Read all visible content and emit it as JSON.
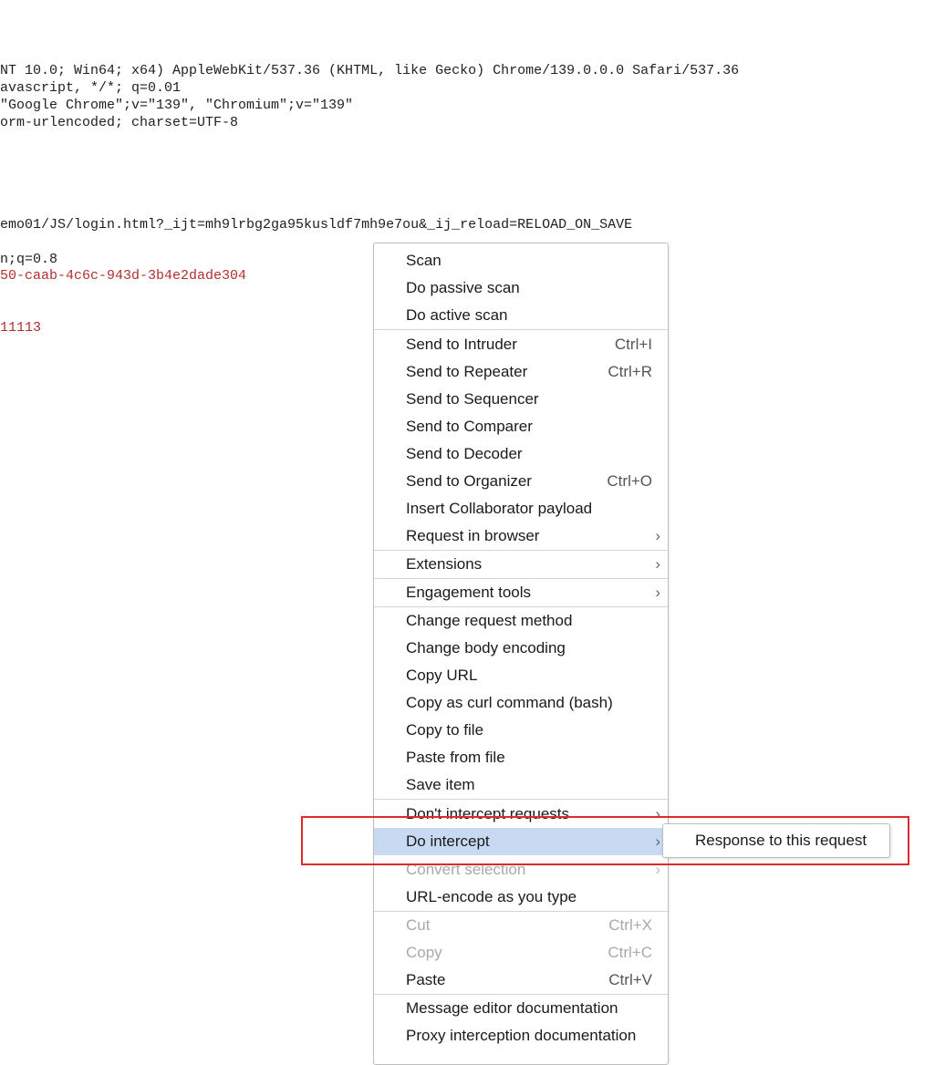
{
  "editor": {
    "lines": [
      {
        "text": "NT 10.0; Win64; x64) AppleWebKit/537.36 (KHTML, like Gecko) Chrome/139.0.0.0 Safari/537.36",
        "color": "#1f1f1f"
      },
      {
        "text": "avascript, */*; q=0.01",
        "color": "#1f1f1f"
      },
      {
        "text": "\"Google Chrome\";v=\"139\", \"Chromium\";v=\"139\"",
        "color": "#1f1f1f"
      },
      {
        "text": "orm-urlencoded; charset=UTF-8",
        "color": "#1f1f1f"
      },
      {
        "text": "emo01/JS/login.html?_ijt=mh9lrbg2ga95kusldf7mh9e7ou&_ij_reload=RELOAD_ON_SAVE",
        "color": "#1f1f1f"
      },
      {
        "text": "n;q=0.8",
        "color": "#1f1f1f"
      },
      {
        "text": "50-caab-4c6c-943d-3b4e2dade304",
        "color": "#b03030"
      },
      {
        "text": "11113",
        "color": "#b03030"
      }
    ]
  },
  "context_menu": {
    "items": [
      {
        "label": "Scan"
      },
      {
        "label": "Do passive scan"
      },
      {
        "label": "Do active scan"
      },
      {
        "label": "Send to Intruder",
        "shortcut": "Ctrl+I"
      },
      {
        "label": "Send to Repeater",
        "shortcut": "Ctrl+R"
      },
      {
        "label": "Send to Sequencer"
      },
      {
        "label": "Send to Comparer"
      },
      {
        "label": "Send to Decoder"
      },
      {
        "label": "Send to Organizer",
        "shortcut": "Ctrl+O"
      },
      {
        "label": "Insert Collaborator payload"
      },
      {
        "label": "Request in browser",
        "submenu": true
      },
      {
        "label": "Extensions",
        "submenu": true
      },
      {
        "label": "Engagement tools",
        "submenu": true
      },
      {
        "label": "Change request method"
      },
      {
        "label": "Change body encoding"
      },
      {
        "label": "Copy URL"
      },
      {
        "label": "Copy as curl command (bash)"
      },
      {
        "label": "Copy to file"
      },
      {
        "label": "Paste from file"
      },
      {
        "label": "Save item"
      },
      {
        "label": "Don't intercept requests",
        "submenu": true
      },
      {
        "label": "Do intercept",
        "submenu": true,
        "highlighted": true
      },
      {
        "label": "Convert selection",
        "submenu": true,
        "disabled": true
      },
      {
        "label": "URL-encode as you type"
      },
      {
        "label": "Cut",
        "shortcut": "Ctrl+X",
        "disabled": true
      },
      {
        "label": "Copy",
        "shortcut": "Ctrl+C",
        "disabled": true
      },
      {
        "label": "Paste",
        "shortcut": "Ctrl+V"
      },
      {
        "label": "Message editor documentation"
      },
      {
        "label": "Proxy interception documentation"
      }
    ],
    "submenu_arrow": "›"
  },
  "submenu": {
    "items": [
      {
        "label": "Response to this request"
      }
    ]
  },
  "colors": {
    "highlight": "#c8daf2",
    "annotation_box": "#e02a2a",
    "code_red": "#b03030"
  },
  "icons": {
    "submenu_arrow": "chevron-right-icon"
  }
}
